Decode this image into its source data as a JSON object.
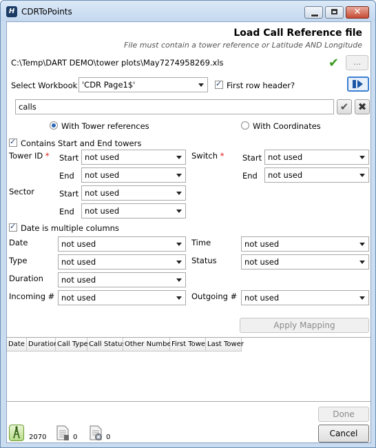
{
  "window": {
    "title": "CDRToPoints",
    "app_icon_glyph": "H",
    "close_glyph": "✕"
  },
  "header": {
    "title": "Load Call Reference file",
    "subtitle": "File must contain a tower reference or Latitude AND Longitude"
  },
  "file": {
    "path": "C:\\Temp\\DART DEMO\\tower plots\\May7274958269.xls",
    "status_icon": "checkmark-icon",
    "browse_label": "..."
  },
  "workbook": {
    "label": "Select Workbook",
    "selected": "'CDR Page1$'",
    "first_row_header_label": "First row header?",
    "first_row_header_checked": true
  },
  "filter": {
    "value": "calls",
    "accept_icon": "check-icon",
    "clear_icon": "x-icon"
  },
  "mode": {
    "tower_label": "With Tower references",
    "coords_label": "With Coordinates",
    "selected": "tower"
  },
  "towers": {
    "contains_label": "Contains Start and End towers",
    "contains_checked": true,
    "tower_id_label": "Tower ID",
    "switch_label": "Switch",
    "sector_label": "Sector",
    "required_mark": "*",
    "start_label": "Start",
    "end_label": "End",
    "tower_id_start": "not used",
    "tower_id_end": "not used",
    "switch_start": "not used",
    "switch_end": "not used",
    "sector_start": "not used",
    "sector_end": "not used"
  },
  "fields": {
    "date_multi_label": "Date is multiple columns",
    "date_multi_checked": true,
    "date_label": "Date",
    "date_value": "not used",
    "time_label": "Time",
    "time_value": "not used",
    "type_label": "Type",
    "type_value": "not used",
    "status_label": "Status",
    "status_value": "not used",
    "duration_label": "Duration",
    "duration_value": "not used",
    "incoming_label": "Incoming #",
    "incoming_value": "not used",
    "outgoing_label": "Outgoing #",
    "outgoing_value": "not used"
  },
  "apply_mapping_label": "Apply Mapping",
  "grid": {
    "columns": [
      "Date",
      "Duration",
      "Call Type",
      "Call Status",
      "Other Number",
      "First Tower",
      "Last Tower"
    ],
    "rows": []
  },
  "buttons": {
    "done_label": "Done",
    "cancel_label": "Cancel"
  },
  "status_bar": {
    "towers_count": "2070",
    "docs_count": "0",
    "errors_count": "0",
    "towers_icon": "tower-icon",
    "docs_icon": "document-icon",
    "errors_icon": "document-error-icon"
  },
  "colors": {
    "accent": "#3c7fd0",
    "ok_green": "#3b9a1f",
    "required_red": "#d11111"
  }
}
